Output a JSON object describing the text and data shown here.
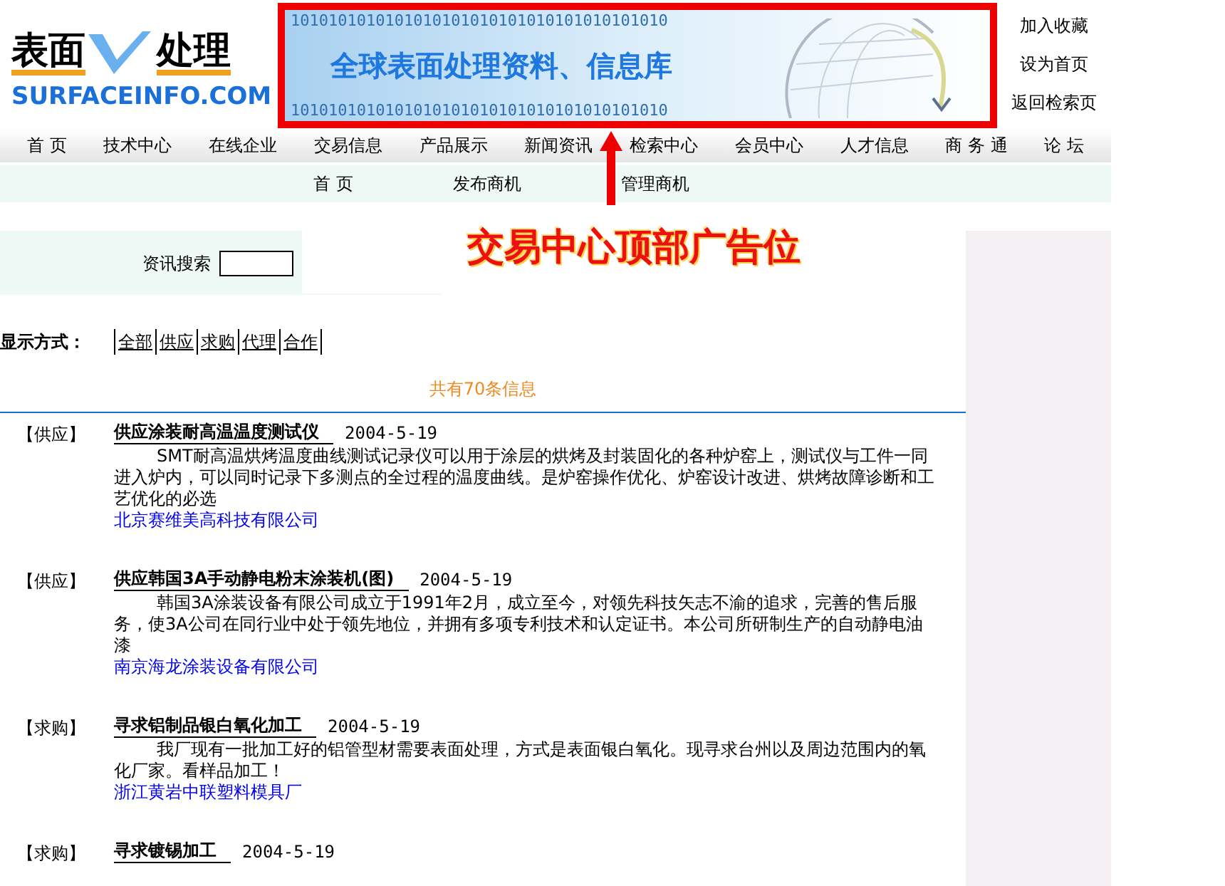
{
  "logo": {
    "left": "表面",
    "right": "处理",
    "domain": "SURFACEINFO.COM"
  },
  "banner": {
    "headline": "全球表面处理资料、信息库",
    "pattern_rows": [
      "1010101010101010101010101010101010101010",
      "1010101010101010101010101010101010101010"
    ]
  },
  "header_links": [
    "加入收藏",
    "设为首页",
    "返回检索页"
  ],
  "nav": [
    "首 页",
    "技术中心",
    "在线企业",
    "交易信息",
    "产品展示",
    "新闻资讯",
    "检索中心",
    "会员中心",
    "人才信息",
    "商 务 通",
    "论 坛"
  ],
  "subnav": [
    "首 页",
    "发布商机",
    "管理商机"
  ],
  "search": {
    "label": "资讯搜索"
  },
  "annotation": {
    "label": "交易中心顶部广告位"
  },
  "display_mode": {
    "label": "显示方式：",
    "options": [
      "全部",
      "供应",
      "求购",
      "代理",
      "合作"
    ]
  },
  "count": "共有70条信息",
  "entries": [
    {
      "category": "【供应】",
      "title": "供应涂装耐高温温度测试仪",
      "date": "2004-5-19",
      "description": "SMT耐高温烘烤温度曲线测试记录仪可以用于涂层的烘烤及封装固化的各种炉窑上，测试仪与工件一同进入炉内，可以同时记录下多测点的全过程的温度曲线。是炉窑操作优化、炉窑设计改进、烘烤故障诊断和工艺优化的必选",
      "company": "北京赛维美高科技有限公司"
    },
    {
      "category": "【供应】",
      "title": "供应韩国3A手动静电粉末涂装机(图)",
      "date": "2004-5-19",
      "description": "韩国3A涂装设备有限公司成立于1991年2月，成立至今，对领先科技矢志不渝的追求，完善的售后服务，使3A公司在同行业中处于领先地位，并拥有多项专利技术和认定证书。本公司所研制生产的自动静电油漆",
      "company": "南京海龙涂装设备有限公司"
    },
    {
      "category": "【求购】",
      "title": "寻求铝制品银白氧化加工",
      "date": "2004-5-19",
      "description": "我厂现有一批加工好的铝管型材需要表面处理，方式是表面银白氧化。现寻求台州以及周边范围内的氧化厂家。看样品加工！",
      "company": "浙江黄岩中联塑料模具厂"
    },
    {
      "category": "【求购】",
      "title": "寻求镀锡加工",
      "date": "2004-5-19"
    }
  ]
}
